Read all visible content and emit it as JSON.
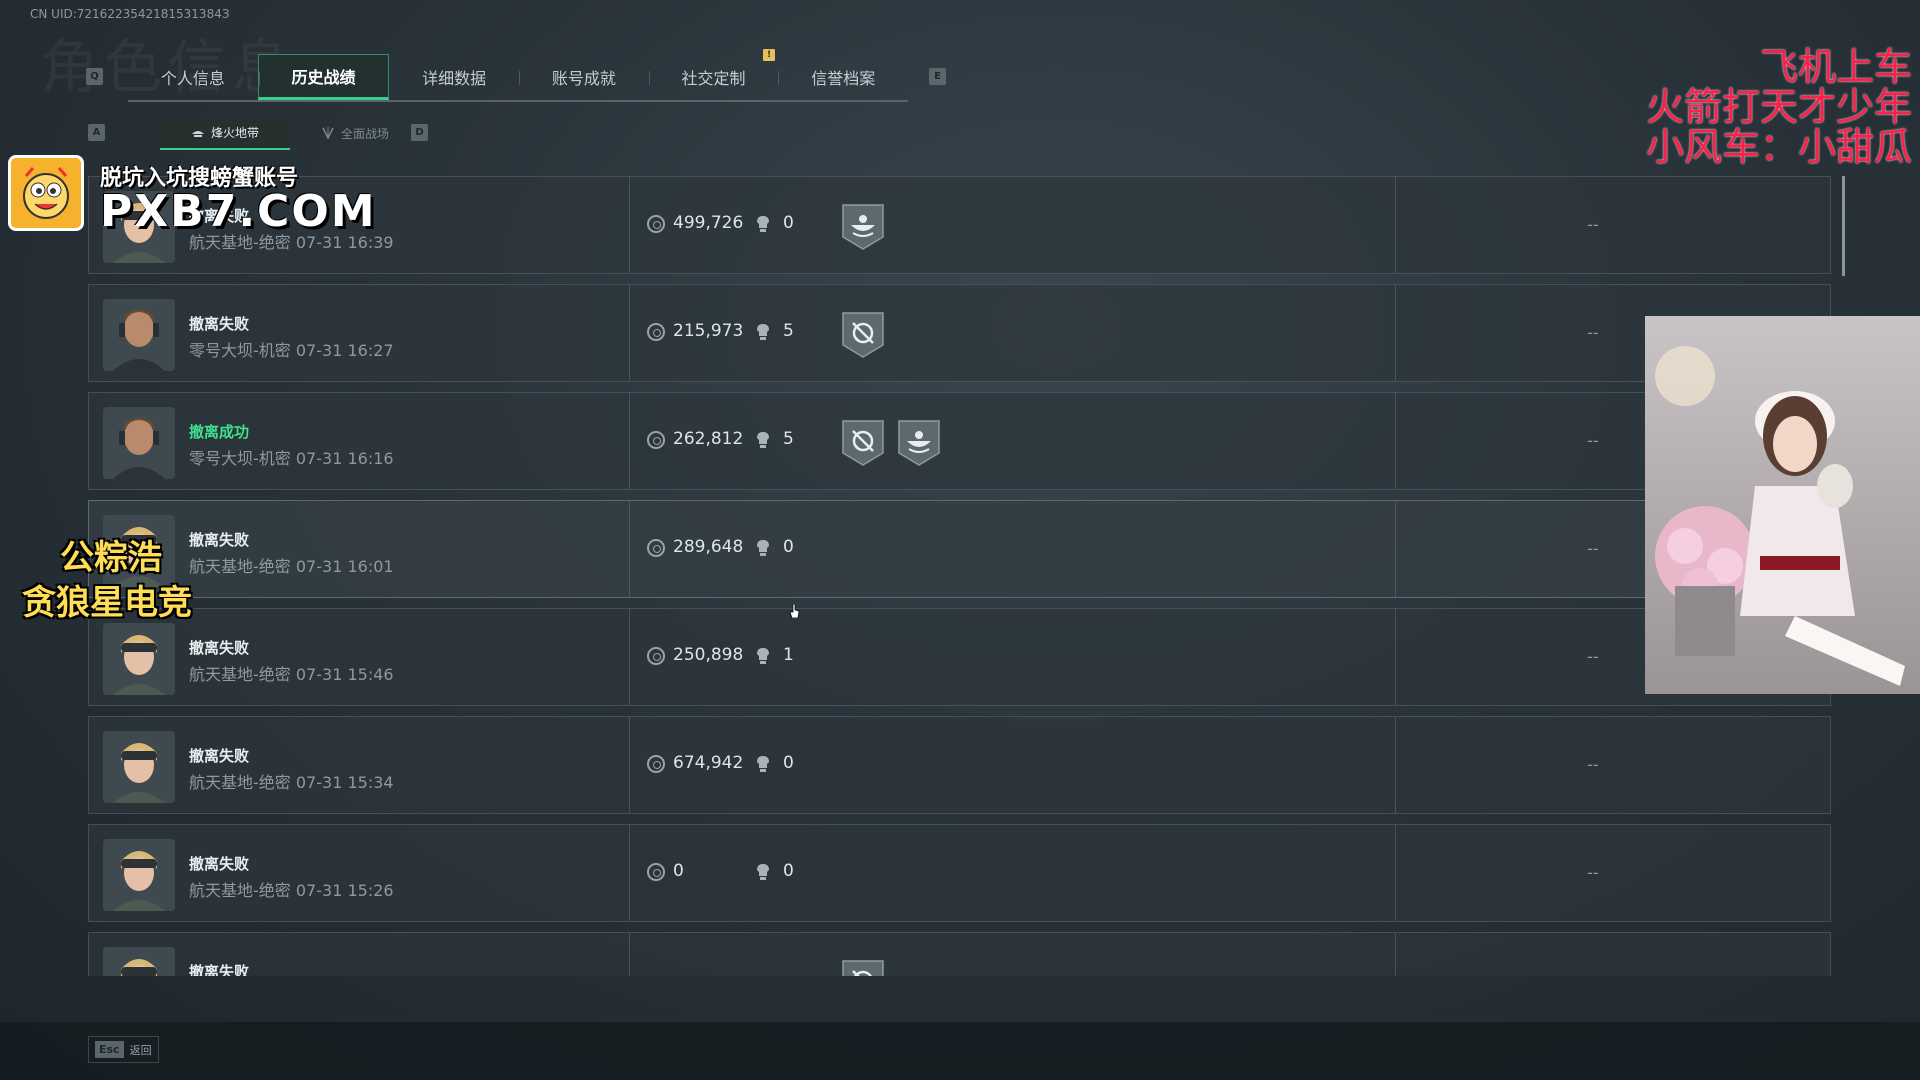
{
  "uid": "CN UID:7216223542181531384З",
  "bg_title": "角色信息",
  "key_hints": {
    "prev_tab": "Q",
    "next_tab": "E",
    "prev_sub": "A",
    "next_sub": "D"
  },
  "tabs": [
    {
      "label": "个人信息",
      "active": false
    },
    {
      "label": "历史战绩",
      "active": true
    },
    {
      "label": "详细数据",
      "active": false
    },
    {
      "label": "账号成就",
      "active": false
    },
    {
      "label": "社交定制",
      "active": false
    },
    {
      "label": "信誉档案",
      "active": false
    }
  ],
  "tab_notice": "!",
  "subtabs": [
    {
      "label": "烽火地带",
      "active": true
    },
    {
      "label": "全面战场",
      "active": false
    }
  ],
  "rows": [
    {
      "status": "撤离失败",
      "map": "航天基地-绝密",
      "time": "07-31 16:39",
      "money": "499,726",
      "kills": "0",
      "badges": [
        "bowl"
      ],
      "result": "--",
      "char": "blonde"
    },
    {
      "status": "撤离失败",
      "map": "零号大坝-机密",
      "time": "07-31 16:27",
      "money": "215,973",
      "kills": "5",
      "badges": [
        "cross"
      ],
      "result": "--",
      "char": "male"
    },
    {
      "status": "撤离成功",
      "map": "零号大坝-机密",
      "time": "07-31 16:16",
      "money": "262,812",
      "kills": "5",
      "badges": [
        "cross",
        "bowl"
      ],
      "result": "--",
      "char": "male"
    },
    {
      "status": "撤离失败",
      "map": "航天基地-绝密",
      "time": "07-31 16:01",
      "money": "289,648",
      "kills": "0",
      "badges": [],
      "result": "--",
      "char": "blonde"
    },
    {
      "status": "撤离失败",
      "map": "航天基地-绝密",
      "time": "07-31 15:46",
      "money": "250,898",
      "kills": "1",
      "badges": [],
      "result": "--",
      "char": "blonde"
    },
    {
      "status": "撤离失败",
      "map": "航天基地-绝密",
      "time": "07-31 15:34",
      "money": "674,942",
      "kills": "0",
      "badges": [],
      "result": "--",
      "char": "blonde"
    },
    {
      "status": "撤离失败",
      "map": "航天基地-绝密",
      "time": "07-31 15:26",
      "money": "0",
      "kills": "0",
      "badges": [],
      "result": "--",
      "char": "blonde"
    },
    {
      "status": "撤离失败",
      "map": "",
      "time": "",
      "money": "",
      "kills": "",
      "badges": [
        "cross"
      ],
      "result": "",
      "char": "blonde"
    }
  ],
  "esc": {
    "key": "Esc",
    "label": "返回"
  },
  "overlays": {
    "wm_line1": "脱坑入坑搜螃蟹账号",
    "wm_line2": "PXB7.COM",
    "sponsor_line1": "公粽浩",
    "sponsor_line2": "贪狼星电竞",
    "red_lines": [
      "飞机上车",
      "火箭打天才少年",
      "小风车：小甜瓜"
    ]
  },
  "colors": {
    "accent": "#39d08f",
    "success": "#3ee08e",
    "overlay_red": "#ff1e4a",
    "notice": "#e6c05b"
  }
}
